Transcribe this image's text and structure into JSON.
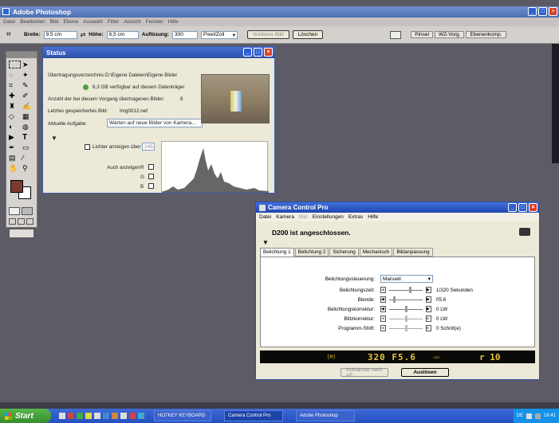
{
  "ps": {
    "title": "Adobe Photoshop",
    "menu": [
      "Datei",
      "Bearbeiten",
      "Bild",
      "Ebene",
      "Auswahl",
      "Filter",
      "Ansicht",
      "Fenster",
      "Hilfe"
    ],
    "options": {
      "breite_label": "Breite:",
      "breite": "9,5 cm",
      "hoehe_label": "Höhe:",
      "hoehe": "6,5 cm",
      "aufloesung_label": "Auflösung:",
      "aufloesung": "300",
      "unit": "Pixel/Zoll",
      "vorderes_bild": "Vorderes Bild",
      "loeschen": "Löschen"
    },
    "palette_tabs": [
      "Pinsel",
      "WZ-Vorg.",
      "Ebenenkomp."
    ]
  },
  "status": {
    "title": "Status",
    "dir_label": "Übertragungsverzeichnis:",
    "dir_value": "D:\\Eigene Dateien\\Eigene Bilder",
    "space": "6,3 GB  verfügbar auf diesem Datenträger",
    "count_label": "Anzahl der bei diesem Vorgang übertragenen Bilder:",
    "count_value": "8",
    "last_label": "Letztes gespeichertes Bild:",
    "last_value": "Img0012.nef",
    "task_label": "Aktuelle Aufgabe:",
    "task_value": "Warten auf neue Bilder von Kamera...",
    "highlights_label": "Lichter anzeigen über",
    "highlights_value": "245",
    "also_label": "Auch anzeigen",
    "channels": [
      "R",
      "G",
      "B"
    ]
  },
  "ccp": {
    "title": "Camera Control Pro",
    "menu": [
      "Datei",
      "Kamera",
      "Bild",
      "Einstellungen",
      "Extras",
      "Hilfe"
    ],
    "connected": "D200 ist angeschlossen.",
    "tabs": [
      "Belichtung 1",
      "Belichtung 2",
      "Sicherung",
      "Mechanisch",
      "Bildanpassung"
    ],
    "steuerung_label": "Belichtungssteuerung:",
    "steuerung_value": "Manuell",
    "rows": [
      {
        "label": "Belichtungszeit:",
        "value": "1/320 Sekunden"
      },
      {
        "label": "Blende:",
        "value": "f/5.6"
      },
      {
        "label": "Belichtungskorrektur:",
        "value": "0 LW"
      },
      {
        "label": "Blitzkorrektur:",
        "value": "0 LW"
      },
      {
        "label": "Programm-Shift:",
        "value": "0 Schritt(e)"
      }
    ],
    "lcd": {
      "mode": "[M]",
      "main": "320 F5.6",
      "frames": "r 10"
    },
    "af_button": "Aufnahme nach AF",
    "shoot_button": "Auslösen"
  },
  "taskbar": {
    "start": "Start",
    "tasks": [
      "HOTKEY KEYBOARD",
      "Camera Control Pro",
      "Adobe Photoshop"
    ],
    "lang": "DE",
    "time": "16:41"
  }
}
